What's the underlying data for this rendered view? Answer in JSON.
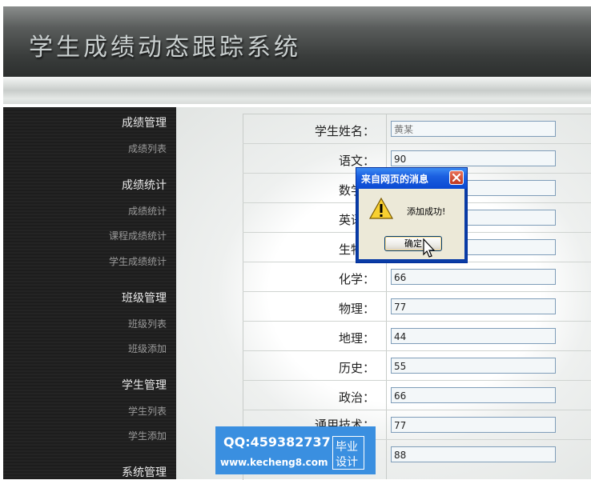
{
  "header": {
    "title": "学生成绩动态跟踪系统"
  },
  "sidebar": {
    "groups": [
      {
        "title": "成绩管理",
        "items": [
          "成绩列表"
        ]
      },
      {
        "title": "成绩统计",
        "items": [
          "成绩统计",
          "课程成绩统计",
          "学生成绩统计"
        ]
      },
      {
        "title": "班级管理",
        "items": [
          "班级列表",
          "班级添加"
        ]
      },
      {
        "title": "学生管理",
        "items": [
          "学生列表",
          "学生添加"
        ]
      },
      {
        "title": "系统管理",
        "items": []
      }
    ]
  },
  "form": {
    "fields": [
      {
        "label": "学生姓名：",
        "value": "",
        "placeholder": "黄某"
      },
      {
        "label": "语文：",
        "value": "90"
      },
      {
        "label": "数学：",
        "value": ""
      },
      {
        "label": "英语：",
        "value": ""
      },
      {
        "label": "生物：",
        "value": ""
      },
      {
        "label": "化学：",
        "value": "66"
      },
      {
        "label": "物理：",
        "value": "77"
      },
      {
        "label": "地理：",
        "value": "44"
      },
      {
        "label": "历史：",
        "value": "55"
      },
      {
        "label": "政治：",
        "value": "66"
      },
      {
        "label": "通用技术：",
        "value": "77"
      },
      {
        "label": "",
        "value": "88"
      }
    ]
  },
  "dialog": {
    "title": "来自网页的消息",
    "message": "添加成功!",
    "ok_label": "确定",
    "icon": "warning-icon"
  },
  "watermark": {
    "qq": "QQ:459382737",
    "url": "www.kecheng8.com",
    "tag_line1": "毕业",
    "tag_line2": "设计"
  },
  "colors": {
    "dialog_title": "#0a49d2",
    "watermark": "#3a8fe0",
    "sidebar": "#1d1d1d"
  }
}
